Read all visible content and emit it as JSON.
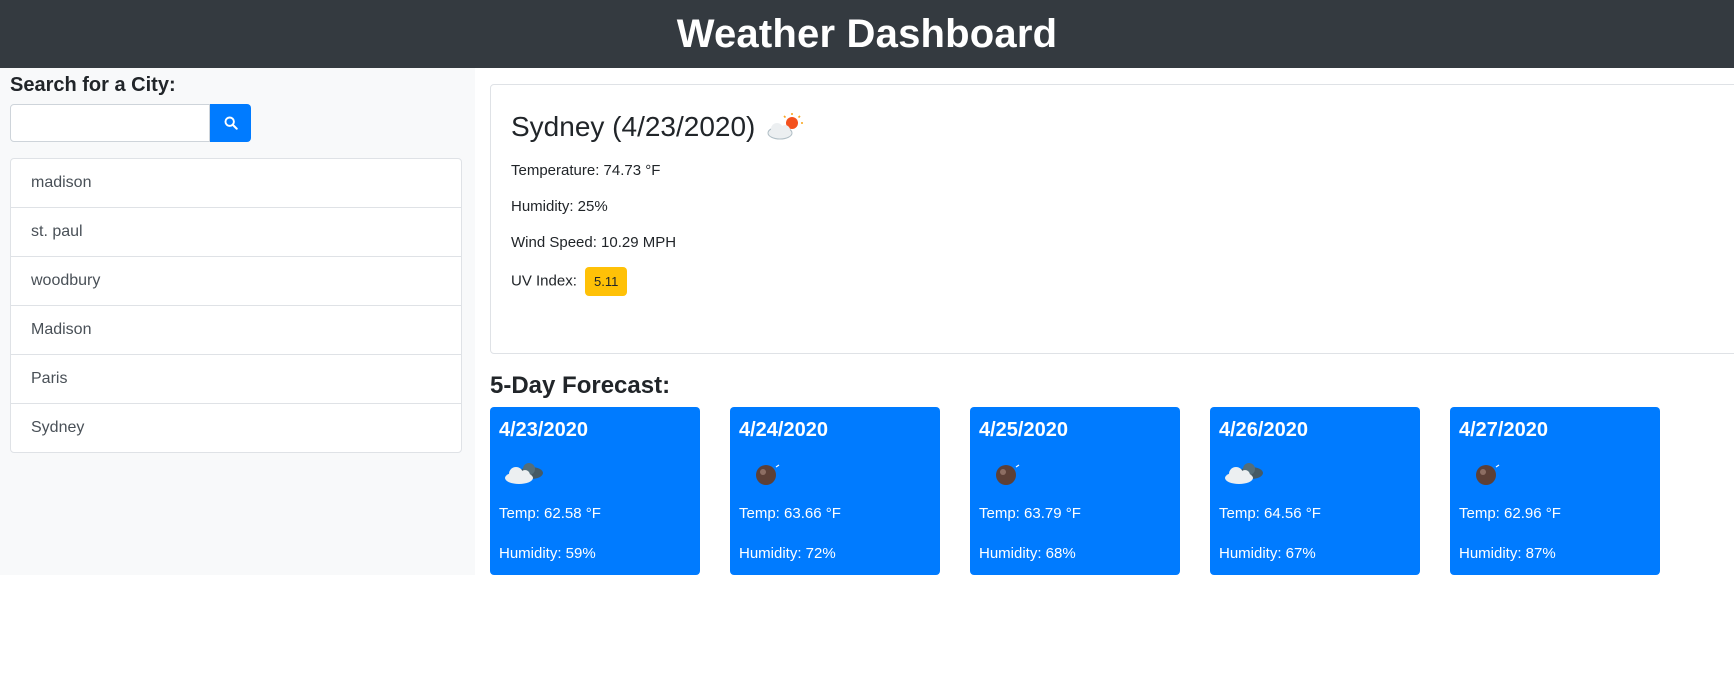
{
  "header": {
    "title": "Weather Dashboard"
  },
  "search": {
    "label": "Search for a City:",
    "value": "",
    "placeholder": "",
    "button_icon": "search-icon"
  },
  "cities": [
    "madison",
    "st. paul",
    "woodbury",
    "Madison",
    "Paris",
    "Sydney"
  ],
  "current": {
    "title": "Sydney (4/23/2020)",
    "icon": "partly-cloudy-sun-icon",
    "temperature": "Temperature: 74.73 °F",
    "humidity": "Humidity: 25%",
    "wind": "Wind Speed: 10.29 MPH",
    "uv_label": "UV Index:",
    "uv_value": "5.11",
    "uv_color": "#ffc107"
  },
  "forecast": {
    "heading": "5-Day Forecast:",
    "accent": "#007bff",
    "days": [
      {
        "date": "4/23/2020",
        "icon": "broken-clouds-icon",
        "temp": "Temp: 62.58 °F",
        "humidity": "Humidity: 59%"
      },
      {
        "date": "4/24/2020",
        "icon": "rain-icon",
        "temp": "Temp: 63.66 °F",
        "humidity": "Humidity: 72%"
      },
      {
        "date": "4/25/2020",
        "icon": "rain-icon",
        "temp": "Temp: 63.79 °F",
        "humidity": "Humidity: 68%"
      },
      {
        "date": "4/26/2020",
        "icon": "broken-clouds-icon",
        "temp": "Temp: 64.56 °F",
        "humidity": "Humidity: 67%"
      },
      {
        "date": "4/27/2020",
        "icon": "rain-icon",
        "temp": "Temp: 62.96 °F",
        "humidity": "Humidity: 87%"
      }
    ]
  }
}
